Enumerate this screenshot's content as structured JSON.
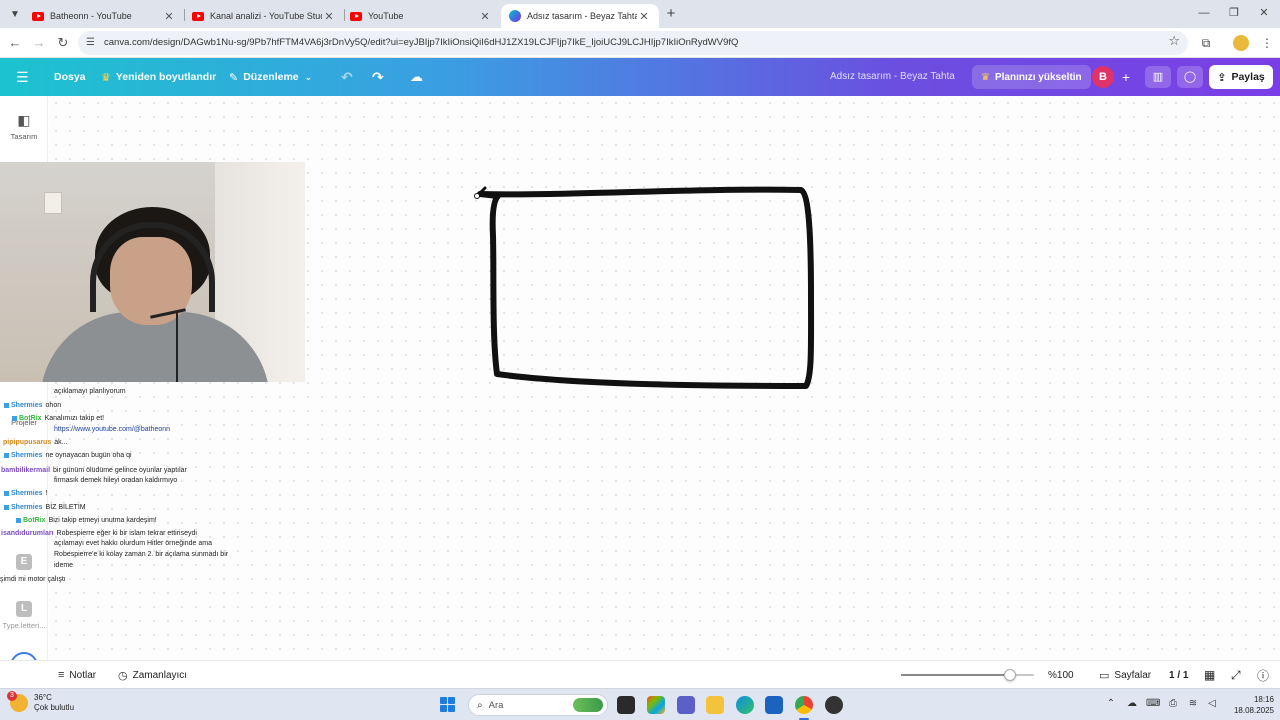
{
  "browser": {
    "tabs": [
      {
        "title": "Batheonn - YouTube",
        "icon": "youtube-icon",
        "active": false
      },
      {
        "title": "Kanal analizi - YouTube Studio",
        "icon": "youtube-icon",
        "active": false
      },
      {
        "title": "YouTube",
        "icon": "youtube-icon",
        "active": false
      },
      {
        "title": "Adsız tasarım - Beyaz Tahta",
        "icon": "canva-icon",
        "active": true
      }
    ],
    "url": "canva.com/design/DAGwb1Nu-sg/9Pb7hfFTM4VA6j3rDnVy5Q/edit?ui=eyJBIjp7IkIiOnsiQiI6dHJ1ZX19LCJFIjp7IkE_IjoiUCJ9LCJHIjp7IkIiOnRydWV9fQ"
  },
  "canva": {
    "menu": {
      "file": "Dosya",
      "resize": "Yeniden boyutlandır",
      "edit": "Düzenleme"
    },
    "design_title": "Adsız tasarım - Beyaz Tahta",
    "upgrade": "Planınızı yükseltin",
    "avatar_letter": "B",
    "share": "Paylaş",
    "sidebar": {
      "design": "Tasarım",
      "projects": "Projeler",
      "tile_e": "E",
      "tile_l": "L",
      "typecast": "Type.letteri..."
    },
    "footer": {
      "notes": "Notlar",
      "timer": "Zamanlayıcı",
      "zoom": "%100",
      "zoom_level": 1.0,
      "pages": "Sayfalar",
      "page_count": "1 / 1"
    }
  },
  "chat": [
    {
      "user": "",
      "text": "açıklamayı planlıyorum",
      "user_color": "#ffffff"
    },
    {
      "user": "Shermies",
      "text": "ohon",
      "user_color": "#2f86d8"
    },
    {
      "user": "BotRix",
      "text": "Kanalımızı takip et!",
      "user_color": "#34b53a"
    },
    {
      "user": "",
      "text": "https://www.youtube.com/@batheonn",
      "user_color": "#ffffff"
    },
    {
      "user": "pipipupusarus",
      "text": "ak...",
      "user_color": "#d48a1e"
    },
    {
      "user": "Shermies",
      "text": "ne oynayacan bugün oha qi",
      "user_color": "#2f86d8"
    },
    {
      "user": "bambilikermail",
      "text": "bir günüm ölüdüme gelince oyunlar yaptılar",
      "user_color": "#7b4bc4"
    },
    {
      "user": "",
      "text": "firmasık demek hileyi oradan kaldırmıyo",
      "user_color": "#ffffff"
    },
    {
      "user": "Shermies",
      "text": "!",
      "user_color": "#2f86d8"
    },
    {
      "user": "Shermies",
      "text": "BİZ BİLETİM",
      "user_color": "#2f86d8"
    },
    {
      "user": "BotRix",
      "text": "Bizi takip etmeyi unutma kardeşim!",
      "user_color": "#34b53a"
    },
    {
      "user": "isandıdurumları",
      "text": "Robespierre eğer ki bir islam tekrar ettiriseydi",
      "user_color": "#7b4bc4"
    },
    {
      "user": "",
      "text": "açılamayı evet hakkı olurdum Hitler örneğinde ama",
      "user_color": "#ffffff"
    },
    {
      "user": "",
      "text": "Robespierre'e ki kolay zaman 2. bir açılama sunmadı bir",
      "user_color": "#ffffff"
    },
    {
      "user": "",
      "text": "ideme",
      "user_color": "#ffffff"
    },
    {
      "user": "",
      "text": "şimdi mi motor çalıştı",
      "user_color": "#ffffff"
    }
  ],
  "taskbar": {
    "weather_temp": "36°C",
    "weather_desc": "Çok bulutlu",
    "weather_badge": "3",
    "search": "Ara",
    "time": "18:16",
    "date": "18.08.2025"
  },
  "colors": {
    "header_gradient_start": "#1cc3cf",
    "header_gradient_end": "#7b3ee6",
    "avatar": "#e0336a",
    "stroke": "#111111"
  }
}
